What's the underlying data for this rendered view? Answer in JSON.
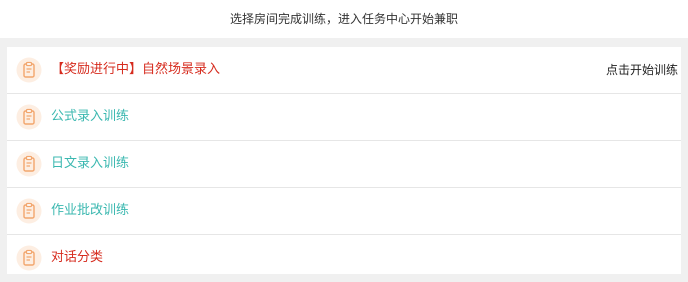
{
  "header": {
    "text": "选择房间完成训练，进入任务中心开始兼职"
  },
  "colors": {
    "red": "#d62b1e",
    "teal": "#3bb8b0",
    "icon_orange": "#f2a56c",
    "icon_bg": "#fdeee2"
  },
  "rooms": [
    {
      "label": "【奖励进行中】自然场景录入",
      "action": "点击开始训练",
      "icon": "clipboard-icon",
      "color": "red"
    },
    {
      "label": "公式录入训练",
      "icon": "clipboard-icon",
      "color": "teal"
    },
    {
      "label": "日文录入训练",
      "icon": "clipboard-icon",
      "color": "teal"
    },
    {
      "label": "作业批改训练",
      "icon": "clipboard-icon",
      "color": "teal"
    },
    {
      "label": "对话分类",
      "icon": "clipboard-icon",
      "color": "red"
    }
  ]
}
